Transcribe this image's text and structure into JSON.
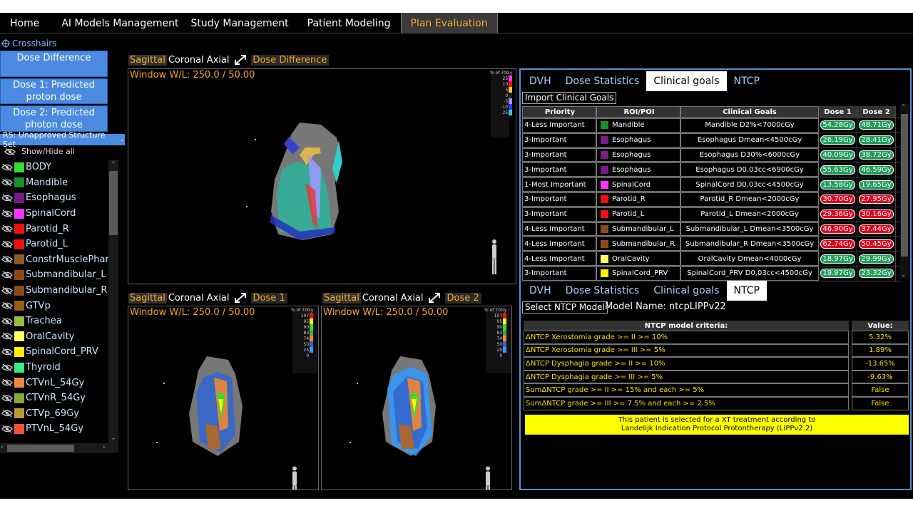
{
  "nav": {
    "tabs": [
      "Home",
      "AI Models Management",
      "Study Management",
      "Patient Modeling",
      "Plan Evaluation"
    ],
    "active": 4
  },
  "left": {
    "crosshairs": "Crosshairs",
    "dose_difference_btn": "Dose Difference",
    "dose1_btn_l1": "Dose 1: Predicted",
    "dose1_btn_l2": "proton dose",
    "dose2_btn_l1": "Dose 2: Predicted",
    "dose2_btn_l2": "photon dose",
    "structure_set": "RS: Unapproved Structure Set",
    "show_hide": "Show/Hide all",
    "structures": [
      {
        "name": "BODY",
        "color": "#33dd33"
      },
      {
        "name": "Mandible",
        "color": "#1a8f2a"
      },
      {
        "name": "Esophagus",
        "color": "#7a1a8a"
      },
      {
        "name": "SpinalCord",
        "color": "#ff33ff"
      },
      {
        "name": "Parotid_R",
        "color": "#ee1111"
      },
      {
        "name": "Parotid_L",
        "color": "#ee1111"
      },
      {
        "name": "ConstrMusclePhary",
        "color": "#8b5a2b"
      },
      {
        "name": "Submandibular_L",
        "color": "#8b4a1a"
      },
      {
        "name": "Submandibular_R",
        "color": "#8b4a1a"
      },
      {
        "name": "GTVp",
        "color": "#9a5a1a"
      },
      {
        "name": "Trachea",
        "color": "#99bb44"
      },
      {
        "name": "OralCavity",
        "color": "#ffff66"
      },
      {
        "name": "SpinalCord_PRV",
        "color": "#ffee00"
      },
      {
        "name": "Thyroid",
        "color": "#33ee88"
      },
      {
        "name": "CTVnL_54Gy",
        "color": "#ee8844"
      },
      {
        "name": "CTVnR_54Gy",
        "color": "#88aa33"
      },
      {
        "name": "CTVp_69Gy",
        "color": "#bb9933"
      },
      {
        "name": "PTVnL_54Gy",
        "color": "#ee5533"
      }
    ]
  },
  "views": {
    "plane_tabs": [
      "Sagittal",
      "Coronal",
      "Axial"
    ],
    "top": {
      "dose_label": "Dose Difference",
      "wl": "Window W/L: 250.0 / 50.00"
    },
    "bl": {
      "dose_label": "Dose 1",
      "wl": "Window W/L: 250.0 / 50.00"
    },
    "br": {
      "dose_label": "Dose 2",
      "wl": "Window W/L: 250.0 / 50.00"
    },
    "diff_legend": {
      "title": "% of 70Gy",
      "levels": [
        "25",
        "10",
        "5",
        "0",
        "-5",
        "-10",
        "-25"
      ],
      "colors": [
        "#ff33ff",
        "#ee1111",
        "#ffcc33",
        "#222222",
        "#9999ff",
        "#3333ff",
        "#33cccc"
      ]
    },
    "dose_legend": {
      "title": "% of 70Gy",
      "levels": [
        "107",
        "95",
        "90",
        "83",
        "74",
        "50",
        "25",
        "0"
      ],
      "colors": [
        "#ee1111",
        "#ffff00",
        "#33dd33",
        "#44aa44",
        "#ee8833",
        "#3366cc",
        "#3399ff",
        "#111111"
      ]
    }
  },
  "right": {
    "tabs": [
      "DVH",
      "Dose Statistics",
      "Clinical goals",
      "NTCP"
    ],
    "top_active": 2,
    "bottom_active": 3,
    "import_btn": "Import Clinical Goals",
    "headers": [
      "Priority",
      "ROI/POI",
      "Clinical Goals",
      "Dose 1",
      "Dose 2"
    ],
    "goals": [
      {
        "priority": "4-Less Important",
        "roi": "Mandible",
        "color": "#1a8f2a",
        "goal": "Mandible D2%<7000cGy",
        "d1": "54.28Gy",
        "d1s": "pass",
        "d2": "48.71Gy",
        "d2s": "pass"
      },
      {
        "priority": "3-Important",
        "roi": "Esophagus",
        "color": "#7a1a8a",
        "goal": "Esophagus Dmean<4500cGy",
        "d1": "26.19Gy",
        "d1s": "pass",
        "d2": "28.41Gy",
        "d2s": "pass"
      },
      {
        "priority": "3-Important",
        "roi": "Esophagus",
        "color": "#7a1a8a",
        "goal": "Esophagus D30%<6000cGy",
        "d1": "40.09Gy",
        "d1s": "pass",
        "d2": "38.72Gy",
        "d2s": "pass"
      },
      {
        "priority": "3-Important",
        "roi": "Esophagus",
        "color": "#7a1a8a",
        "goal": "Esophagus D0,03cc<6900cGy",
        "d1": "55.63Gy",
        "d1s": "pass",
        "d2": "46.59Gy",
        "d2s": "pass"
      },
      {
        "priority": "1-Most Important",
        "roi": "SpinalCord",
        "color": "#ff33ff",
        "goal": "SpinalCord D0,03cc<4500cGy",
        "d1": "13.58Gy",
        "d1s": "pass",
        "d2": "19.65Gy",
        "d2s": "pass"
      },
      {
        "priority": "3-Important",
        "roi": "Parotid_R",
        "color": "#ee1111",
        "goal": "Parotid_R Dmean<2000cGy",
        "d1": "30.70Gy",
        "d1s": "fail",
        "d2": "27.95Gy",
        "d2s": "fail"
      },
      {
        "priority": "3-Important",
        "roi": "Parotid_L",
        "color": "#ee1111",
        "goal": "Parotid_L Dmean<2000cGy",
        "d1": "29.36Gy",
        "d1s": "fail",
        "d2": "30.16Gy",
        "d2s": "fail"
      },
      {
        "priority": "4-Less Important",
        "roi": "Submandibular_L",
        "color": "#8b4a1a",
        "goal": "Submandibular_L Dmean<3500cGy",
        "d1": "46.90Gy",
        "d1s": "fail",
        "d2": "37.44Gy",
        "d2s": "fail"
      },
      {
        "priority": "4-Less Important",
        "roi": "Submandibular_R",
        "color": "#8b4a1a",
        "goal": "Submandibular_R Dmean<3500cGy",
        "d1": "62.74Gy",
        "d1s": "fail",
        "d2": "50.45Gy",
        "d2s": "fail"
      },
      {
        "priority": "4-Less Important",
        "roi": "OralCavity",
        "color": "#ffff66",
        "goal": "OralCavity Dmean<4000cGy",
        "d1": "18.97Gy",
        "d1s": "pass",
        "d2": "29.99Gy",
        "d2s": "pass"
      },
      {
        "priority": "3-Important",
        "roi": "SpinalCord_PRV",
        "color": "#ffee00",
        "goal": "SpinalCord_PRV D0,03cc<4500cGy",
        "d1": "19.97Gy",
        "d1s": "pass",
        "d2": "23.32Gy",
        "d2s": "pass"
      }
    ],
    "select_ntcp_btn": "Select NTCP Model",
    "model_name": "Model Name: ntcpLIPPv22",
    "ntcp_headers": [
      "NTCP model criteria:",
      "Value:"
    ],
    "ntcp_rows": [
      {
        "criteria": "ΔNTCP Xerostomia grade >= II >= 10%",
        "value": "5.32%"
      },
      {
        "criteria": "ΔNTCP Xerostomia grade >= III >= 5%",
        "value": "1.89%"
      },
      {
        "criteria": "ΔNTCP Dysphagia grade >= II >= 10%",
        "value": "-13.65%"
      },
      {
        "criteria": "ΔNTCP Dysphagia grade >= III >= 5%",
        "value": "-9.63%"
      },
      {
        "criteria": "SumΔNTCP grade >= II >= 15% and each >= 5%",
        "value": "False"
      },
      {
        "criteria": "SumΔNTCP grade >= III >= 7.5% and each >= 2.5%",
        "value": "False"
      }
    ],
    "banner_l1": "This patient is selected for a XT treatment according to",
    "banner_l2": "Landelijk Indication Protocol Protontherapy (LIPPv2.2)"
  }
}
